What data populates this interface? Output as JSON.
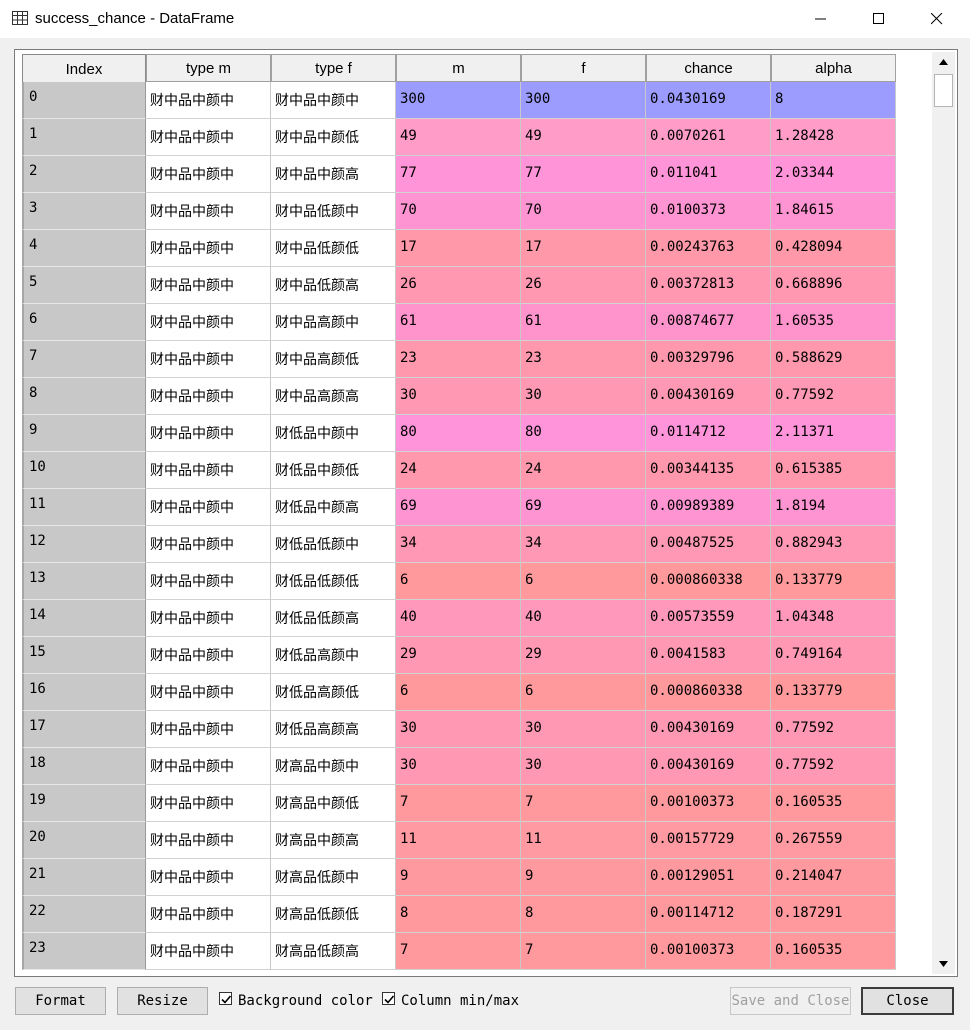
{
  "window": {
    "title": "success_chance - DataFrame",
    "icon": "table-icon"
  },
  "columns": [
    "type m",
    "type f",
    "m",
    "f",
    "chance",
    "alpha"
  ],
  "index_header": "Index",
  "rows": [
    {
      "index": "0",
      "type_m": "财中品中颜中",
      "type_f": "财中品中颜中",
      "m": "300",
      "f": "300",
      "chance": "0.0430169",
      "alpha": "8",
      "color": "#9c9cff"
    },
    {
      "index": "1",
      "type_m": "财中品中颜中",
      "type_f": "财中品中颜低",
      "m": "49",
      "f": "49",
      "chance": "0.0070261",
      "alpha": "1.28428",
      "color": "#ff9cc8"
    },
    {
      "index": "2",
      "type_m": "财中品中颜中",
      "type_f": "财中品中颜高",
      "m": "77",
      "f": "77",
      "chance": "0.011041",
      "alpha": "2.03344",
      "color": "#ff94d8"
    },
    {
      "index": "3",
      "type_m": "财中品中颜中",
      "type_f": "财中品低颜中",
      "m": "70",
      "f": "70",
      "chance": "0.0100373",
      "alpha": "1.84615",
      "color": "#ff94d2"
    },
    {
      "index": "4",
      "type_m": "财中品中颜中",
      "type_f": "财中品低颜低",
      "m": "17",
      "f": "17",
      "chance": "0.00243763",
      "alpha": "0.428094",
      "color": "#ff98a8"
    },
    {
      "index": "5",
      "type_m": "财中品中颜中",
      "type_f": "财中品低颜高",
      "m": "26",
      "f": "26",
      "chance": "0.00372813",
      "alpha": "0.668896",
      "color": "#ff98b0"
    },
    {
      "index": "6",
      "type_m": "财中品中颜中",
      "type_f": "财中品高颜中",
      "m": "61",
      "f": "61",
      "chance": "0.00874677",
      "alpha": "1.60535",
      "color": "#ff94cc"
    },
    {
      "index": "7",
      "type_m": "财中品中颜中",
      "type_f": "财中品高颜低",
      "m": "23",
      "f": "23",
      "chance": "0.00329796",
      "alpha": "0.588629",
      "color": "#ff98ac"
    },
    {
      "index": "8",
      "type_m": "财中品中颜中",
      "type_f": "财中品高颜高",
      "m": "30",
      "f": "30",
      "chance": "0.00430169",
      "alpha": "0.77592",
      "color": "#ff98b2"
    },
    {
      "index": "9",
      "type_m": "财中品中颜中",
      "type_f": "财低品中颜中",
      "m": "80",
      "f": "80",
      "chance": "0.0114712",
      "alpha": "2.11371",
      "color": "#ff94da"
    },
    {
      "index": "10",
      "type_m": "财中品中颜中",
      "type_f": "财低品中颜低",
      "m": "24",
      "f": "24",
      "chance": "0.00344135",
      "alpha": "0.615385",
      "color": "#ff98ad"
    },
    {
      "index": "11",
      "type_m": "财中品中颜中",
      "type_f": "财低品中颜高",
      "m": "69",
      "f": "69",
      "chance": "0.00989389",
      "alpha": "1.8194",
      "color": "#ff94d2"
    },
    {
      "index": "12",
      "type_m": "财中品中颜中",
      "type_f": "财低品低颜中",
      "m": "34",
      "f": "34",
      "chance": "0.00487525",
      "alpha": "0.882943",
      "color": "#ff98b5"
    },
    {
      "index": "13",
      "type_m": "财中品中颜中",
      "type_f": "财低品低颜低",
      "m": "6",
      "f": "6",
      "chance": "0.000860338",
      "alpha": "0.133779",
      "color": "#ff999c"
    },
    {
      "index": "14",
      "type_m": "财中品中颜中",
      "type_f": "财低品低颜高",
      "m": "40",
      "f": "40",
      "chance": "0.00573559",
      "alpha": "1.04348",
      "color": "#ff98bb"
    },
    {
      "index": "15",
      "type_m": "财中品中颜中",
      "type_f": "财低品高颜中",
      "m": "29",
      "f": "29",
      "chance": "0.0041583",
      "alpha": "0.749164",
      "color": "#ff98b2"
    },
    {
      "index": "16",
      "type_m": "财中品中颜中",
      "type_f": "财低品高颜低",
      "m": "6",
      "f": "6",
      "chance": "0.000860338",
      "alpha": "0.133779",
      "color": "#ff999c"
    },
    {
      "index": "17",
      "type_m": "财中品中颜中",
      "type_f": "财低品高颜高",
      "m": "30",
      "f": "30",
      "chance": "0.00430169",
      "alpha": "0.77592",
      "color": "#ff98b2"
    },
    {
      "index": "18",
      "type_m": "财中品中颜中",
      "type_f": "财高品中颜中",
      "m": "30",
      "f": "30",
      "chance": "0.00430169",
      "alpha": "0.77592",
      "color": "#ff98b2"
    },
    {
      "index": "19",
      "type_m": "财中品中颜中",
      "type_f": "财高品中颜低",
      "m": "7",
      "f": "7",
      "chance": "0.00100373",
      "alpha": "0.160535",
      "color": "#ff999d"
    },
    {
      "index": "20",
      "type_m": "财中品中颜中",
      "type_f": "财高品中颜高",
      "m": "11",
      "f": "11",
      "chance": "0.00157729",
      "alpha": "0.267559",
      "color": "#ff99a2"
    },
    {
      "index": "21",
      "type_m": "财中品中颜中",
      "type_f": "财高品低颜中",
      "m": "9",
      "f": "9",
      "chance": "0.00129051",
      "alpha": "0.214047",
      "color": "#ff99a0"
    },
    {
      "index": "22",
      "type_m": "财中品中颜中",
      "type_f": "财高品低颜低",
      "m": "8",
      "f": "8",
      "chance": "0.00114712",
      "alpha": "0.187291",
      "color": "#ff999e"
    },
    {
      "index": "23",
      "type_m": "财中品中颜中",
      "type_f": "财高品低颜高",
      "m": "7",
      "f": "7",
      "chance": "0.00100373",
      "alpha": "0.160535",
      "color": "#ff999d"
    }
  ],
  "footer": {
    "format_label": "Format",
    "resize_label": "Resize",
    "bg_color_label": "Background color",
    "bg_color_checked": true,
    "col_minmax_label": "Column min/max",
    "col_minmax_checked": true,
    "save_close_label": "Save and Close",
    "close_label": "Close"
  },
  "colors": {
    "index_bg": "#c8c8c8",
    "header_bg": "#f0f0f0"
  }
}
